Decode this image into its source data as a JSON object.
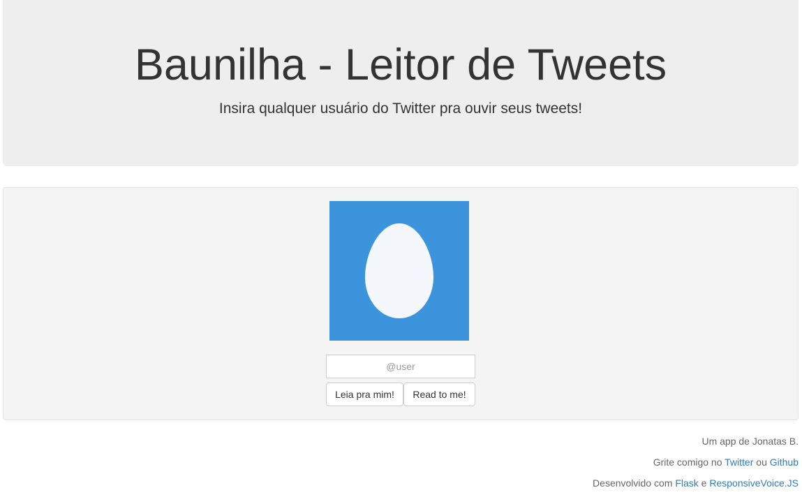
{
  "header": {
    "title": "Baunilha - Leitor de Tweets",
    "subtitle": "Insira qualquer usuário do Twitter pra ouvir seus tweets!"
  },
  "main": {
    "avatar_icon": "default-egg-avatar-icon",
    "avatar_bg_color": "#3c94dc",
    "user_input": {
      "value": "",
      "placeholder": "@user"
    },
    "buttons": {
      "read_pt": "Leia pra mim!",
      "read_en": "Read to me!"
    }
  },
  "footer": {
    "credit": "Um app de Jonatas B.",
    "contact_prefix": "Grite comigo no",
    "twitter_link": "Twitter",
    "contact_sep": "ou",
    "github_link": "Github",
    "dev_prefix": "Desenvolvido com",
    "flask_link": "Flask",
    "dev_sep": "e",
    "rv_link": "ResponsiveVoice.JS"
  },
  "colors": {
    "link": "#337ab7",
    "jumbotron_bg": "#eeeeee",
    "well_bg": "#f4f4f4"
  }
}
